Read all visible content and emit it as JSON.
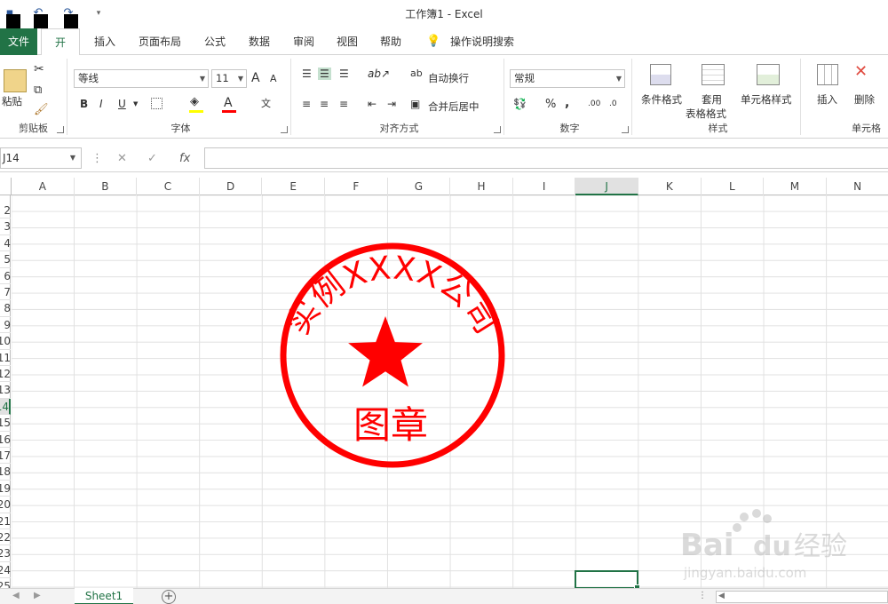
{
  "window": {
    "title": "工作簿1  -  Excel"
  },
  "tabs": {
    "file": "文件",
    "home": "开始",
    "insert": "插入",
    "page_layout": "页面布局",
    "formulas": "公式",
    "data": "数据",
    "review": "审阅",
    "view": "视图",
    "help": "帮助",
    "tell_me": "操作说明搜索"
  },
  "ribbon": {
    "clipboard": {
      "paste": "粘贴",
      "label": "剪贴板"
    },
    "font": {
      "font_name": "等线",
      "font_size": "11",
      "label": "字体",
      "bold": "B",
      "italic": "I",
      "underline": "U",
      "grow": "A",
      "shrink": "A",
      "font_color_letter": "A",
      "phonetic": "文"
    },
    "alignment": {
      "wrap_text": "自动换行",
      "merge_center": "合并后居中",
      "label": "对齐方式"
    },
    "number": {
      "format": "常规",
      "label": "数字",
      "percent": "%",
      "comma": ",",
      "inc_decimal": ".00",
      "dec_decimal": ".0"
    },
    "styles": {
      "conditional": "条件格式",
      "table_line1": "套用",
      "table_line2": "表格格式",
      "cell_styles": "单元格样式",
      "label": "样式"
    },
    "cells": {
      "insert": "插入",
      "delete": "删除",
      "label": "单元格"
    }
  },
  "formula_bar": {
    "name_box": "J14",
    "cancel": "✕",
    "enter": "✓",
    "fx": "fx",
    "content": ""
  },
  "grid": {
    "columns": [
      "A",
      "B",
      "C",
      "D",
      "E",
      "F",
      "G",
      "H",
      "I",
      "J",
      "K",
      "L",
      "M",
      "N"
    ],
    "selected_column": "J",
    "rows": [
      "2",
      "3",
      "4",
      "5",
      "6",
      "7",
      "8",
      "9",
      "10",
      "11",
      "12",
      "13",
      "14",
      "15",
      "16",
      "17",
      "18",
      "19",
      "20",
      "21",
      "22",
      "23",
      "24",
      "25"
    ],
    "selected_row": "14",
    "active_cell": "J14"
  },
  "stamp": {
    "arc_text": "实例XXXX公司",
    "bottom_text": "图章",
    "color": "#ff0000"
  },
  "sheets": {
    "tabs": [
      "Sheet1"
    ],
    "add_label": "+"
  },
  "watermark": {
    "brand": "Bai",
    "brand2": "du",
    "cn": "经验",
    "url": "jingyan.baidu.com"
  },
  "colors": {
    "accent": "#217346",
    "stamp": "#ff0000"
  }
}
